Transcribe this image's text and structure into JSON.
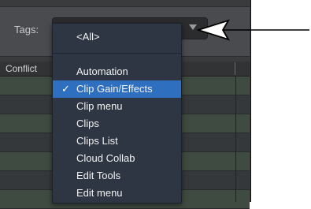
{
  "tags": {
    "label": "Tags:",
    "selected": "<All>"
  },
  "table": {
    "conflict_header": "Conflict"
  },
  "dropdown": {
    "all_label": "<All>",
    "items": [
      {
        "label": "Automation",
        "checked": false
      },
      {
        "label": "Clip Gain/Effects",
        "checked": true
      },
      {
        "label": "Clip menu",
        "checked": false
      },
      {
        "label": "Clips",
        "checked": false
      },
      {
        "label": "Clips List",
        "checked": false
      },
      {
        "label": "Cloud Collab",
        "checked": false
      },
      {
        "label": "Edit Tools",
        "checked": false
      },
      {
        "label": "Edit menu",
        "checked": false
      }
    ],
    "check_glyph": "✓"
  },
  "colors": {
    "menu_bg": "#2e3644",
    "selection": "#2f6fc0",
    "panel_bg": "#4a4b4e",
    "row_green": "#3f4b40"
  }
}
